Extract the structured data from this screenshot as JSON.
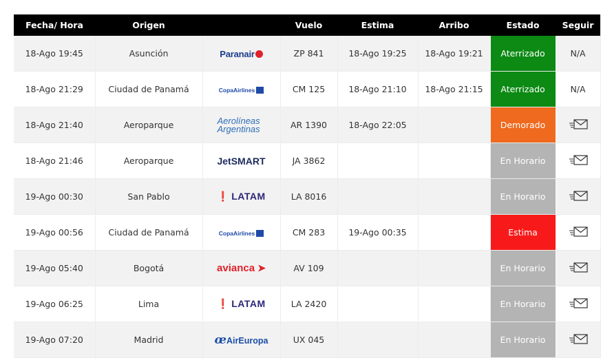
{
  "headers": [
    "Fecha/ Hora",
    "Origen",
    "",
    "Vuelo",
    "Estima",
    "Arribo",
    "Estado",
    "Seguir"
  ],
  "colors": {
    "landed": "#0c8a14",
    "delayed": "#ef6a1f",
    "on_time": "#b4b4b4",
    "estimated": "#f81a1a"
  },
  "flights": [
    {
      "fecha": "18-Ago 19:45",
      "origen": "Asunción",
      "airline": "paranair",
      "logo_text": "Paranair",
      "vuelo": "ZP 841",
      "estima": "18-Ago 19:25",
      "arribo": "18-Ago 19:21",
      "estado": "Aterrizado",
      "status_color": "landed",
      "seguir": "N/A",
      "seguir_icon": "mail-icon"
    },
    {
      "fecha": "18-Ago 21:29",
      "origen": "Ciudad de Panamá",
      "airline": "copa",
      "logo_text": "CopaAirlines",
      "vuelo": "CM 125",
      "estima": "18-Ago 21:10",
      "arribo": "18-Ago 21:15",
      "estado": "Aterrizado",
      "status_color": "landed",
      "seguir": "N/A",
      "seguir_icon": "mail-icon"
    },
    {
      "fecha": "18-Ago 21:40",
      "origen": "Aeroparque",
      "airline": "aerolineas",
      "logo_text": "Aerolíneas Argentinas",
      "vuelo": "AR 1390",
      "estima": "18-Ago 22:05",
      "arribo": "",
      "estado": "Demorado",
      "status_color": "delayed",
      "seguir": "",
      "seguir_icon": "mail-icon"
    },
    {
      "fecha": "18-Ago 21:46",
      "origen": "Aeroparque",
      "airline": "jetsmart",
      "logo_text": "JetSMART",
      "vuelo": "JA 3862",
      "estima": "",
      "arribo": "",
      "estado": "En Horario",
      "status_color": "on_time",
      "seguir": "",
      "seguir_icon": "mail-icon"
    },
    {
      "fecha": "19-Ago 00:30",
      "origen": "San Pablo",
      "airline": "latam",
      "logo_text": "LATAM",
      "vuelo": "LA 8016",
      "estima": "",
      "arribo": "",
      "estado": "En Horario",
      "status_color": "on_time",
      "seguir": "",
      "seguir_icon": "mail-icon"
    },
    {
      "fecha": "19-Ago 00:56",
      "origen": "Ciudad de Panamá",
      "airline": "copa",
      "logo_text": "CopaAirlines",
      "vuelo": "CM 283",
      "estima": "19-Ago 00:35",
      "arribo": "",
      "estado": "Estima",
      "status_color": "estimated",
      "seguir": "",
      "seguir_icon": "mail-icon"
    },
    {
      "fecha": "19-Ago 05:40",
      "origen": "Bogotá",
      "airline": "avianca",
      "logo_text": "avianca",
      "vuelo": "AV 109",
      "estima": "",
      "arribo": "",
      "estado": "En Horario",
      "status_color": "on_time",
      "seguir": "",
      "seguir_icon": "mail-icon"
    },
    {
      "fecha": "19-Ago 06:25",
      "origen": "Lima",
      "airline": "latam",
      "logo_text": "LATAM",
      "vuelo": "LA 2420",
      "estima": "",
      "arribo": "",
      "estado": "En Horario",
      "status_color": "on_time",
      "seguir": "",
      "seguir_icon": "mail-icon"
    },
    {
      "fecha": "19-Ago 07:20",
      "origen": "Madrid",
      "airline": "aireuropa",
      "logo_text": "AirEuropa",
      "vuelo": "UX 045",
      "estima": "",
      "arribo": "",
      "estado": "En Horario",
      "status_color": "on_time",
      "seguir": "",
      "seguir_icon": "mail-icon"
    }
  ]
}
